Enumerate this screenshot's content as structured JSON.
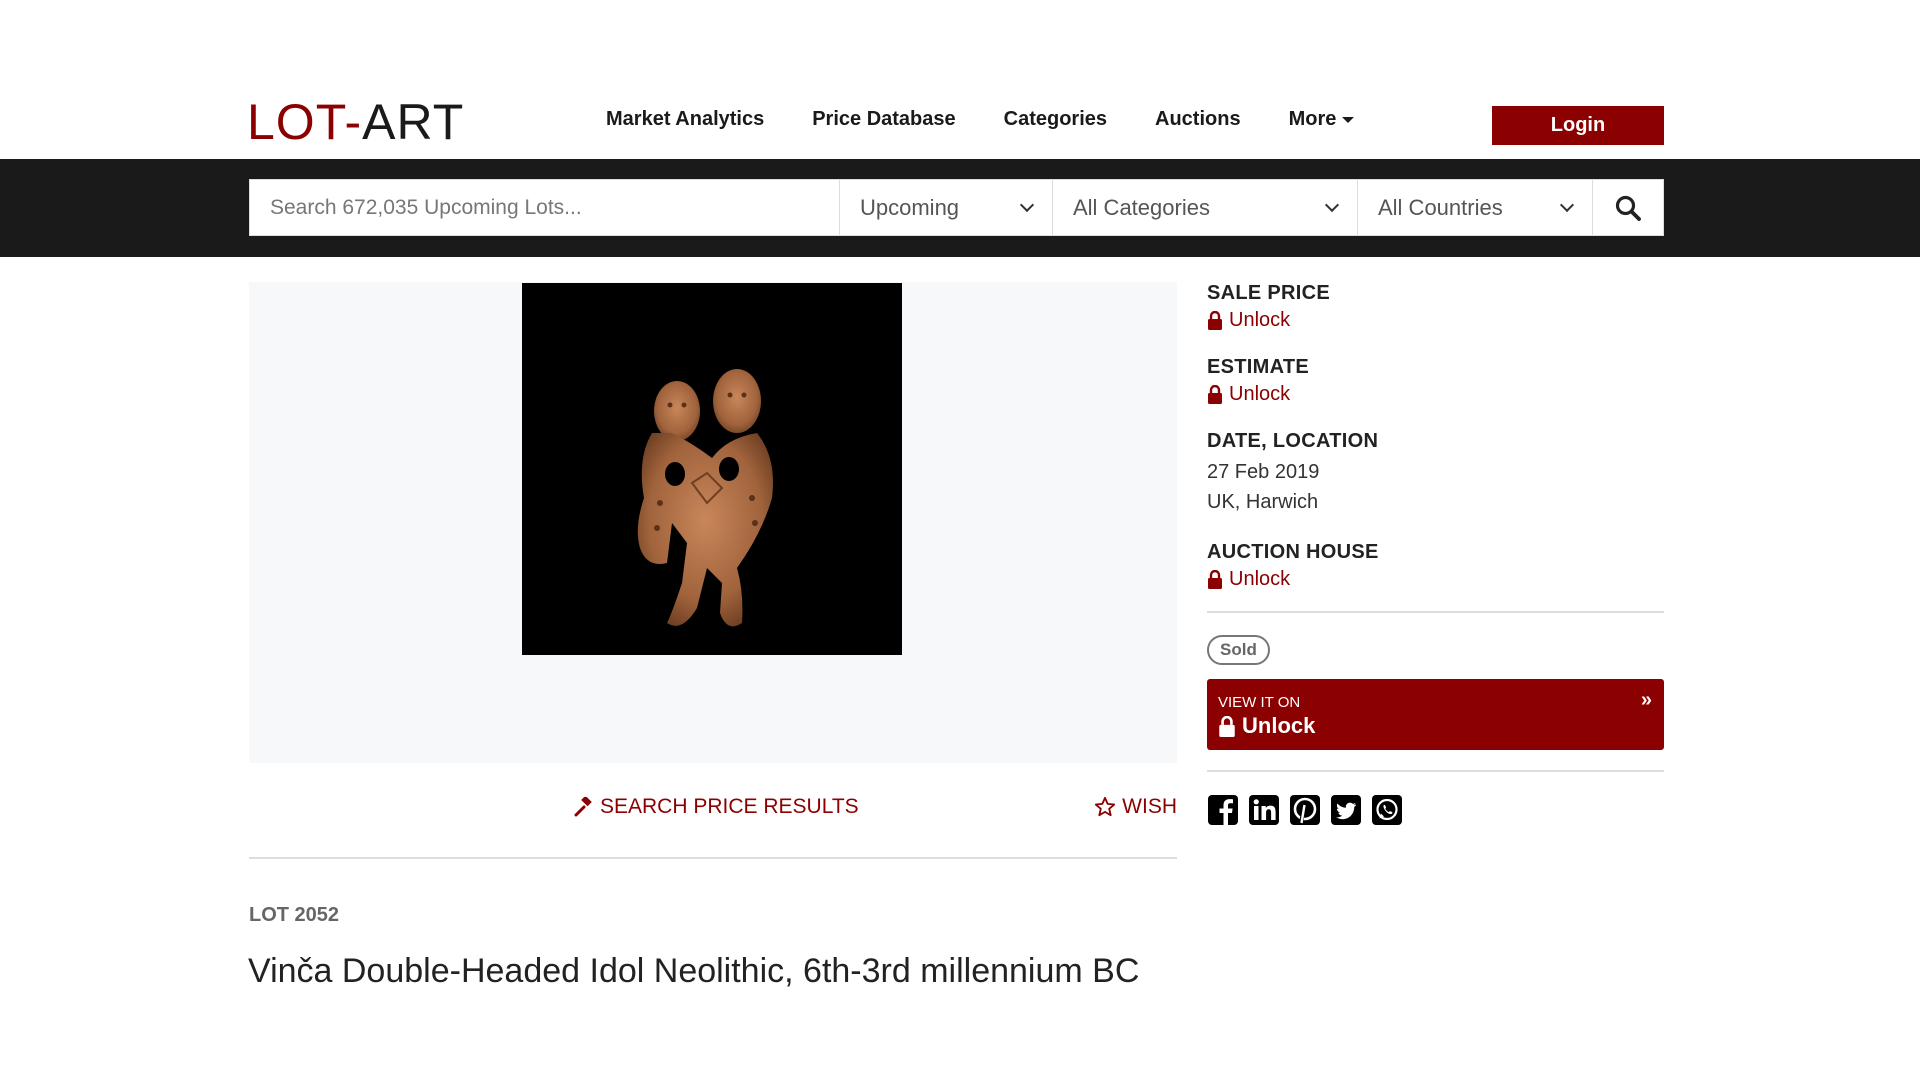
{
  "header": {
    "logo_part1": "LOT",
    "logo_dash": "-",
    "logo_part2": "ART",
    "nav": [
      "Market Analytics",
      "Price Database",
      "Categories",
      "Auctions",
      "More"
    ],
    "login_label": "Login"
  },
  "search": {
    "placeholder": "Search 672,035 Upcoming Lots...",
    "status_select": "Upcoming",
    "category_select": "All Categories",
    "country_select": "All Countries"
  },
  "actions": {
    "search_results_label": "SEARCH PRICE RESULTS",
    "wish_label": "WISH"
  },
  "lot": {
    "number": "LOT 2052",
    "title": "Vinča Double-Headed Idol Neolithic, 6th-3rd millennium BC"
  },
  "info": {
    "sale_price_label": "SALE PRICE",
    "estimate_label": "ESTIMATE",
    "date_location_label": "DATE, LOCATION",
    "date": "27 Feb 2019",
    "location": "UK, Harwich",
    "auction_house_label": "AUCTION HOUSE",
    "unlock_label": "Unlock",
    "status_badge": "Sold",
    "view_it_on": "VIEW IT ON",
    "view_unlock": "Unlock",
    "view_arrow": "»"
  },
  "social_icons": [
    "facebook-icon",
    "linkedin-icon",
    "pinterest-icon",
    "twitter-icon",
    "whatsapp-icon"
  ],
  "colors": {
    "brand": "#8b0000",
    "dark_bar": "#1a1a1a"
  }
}
